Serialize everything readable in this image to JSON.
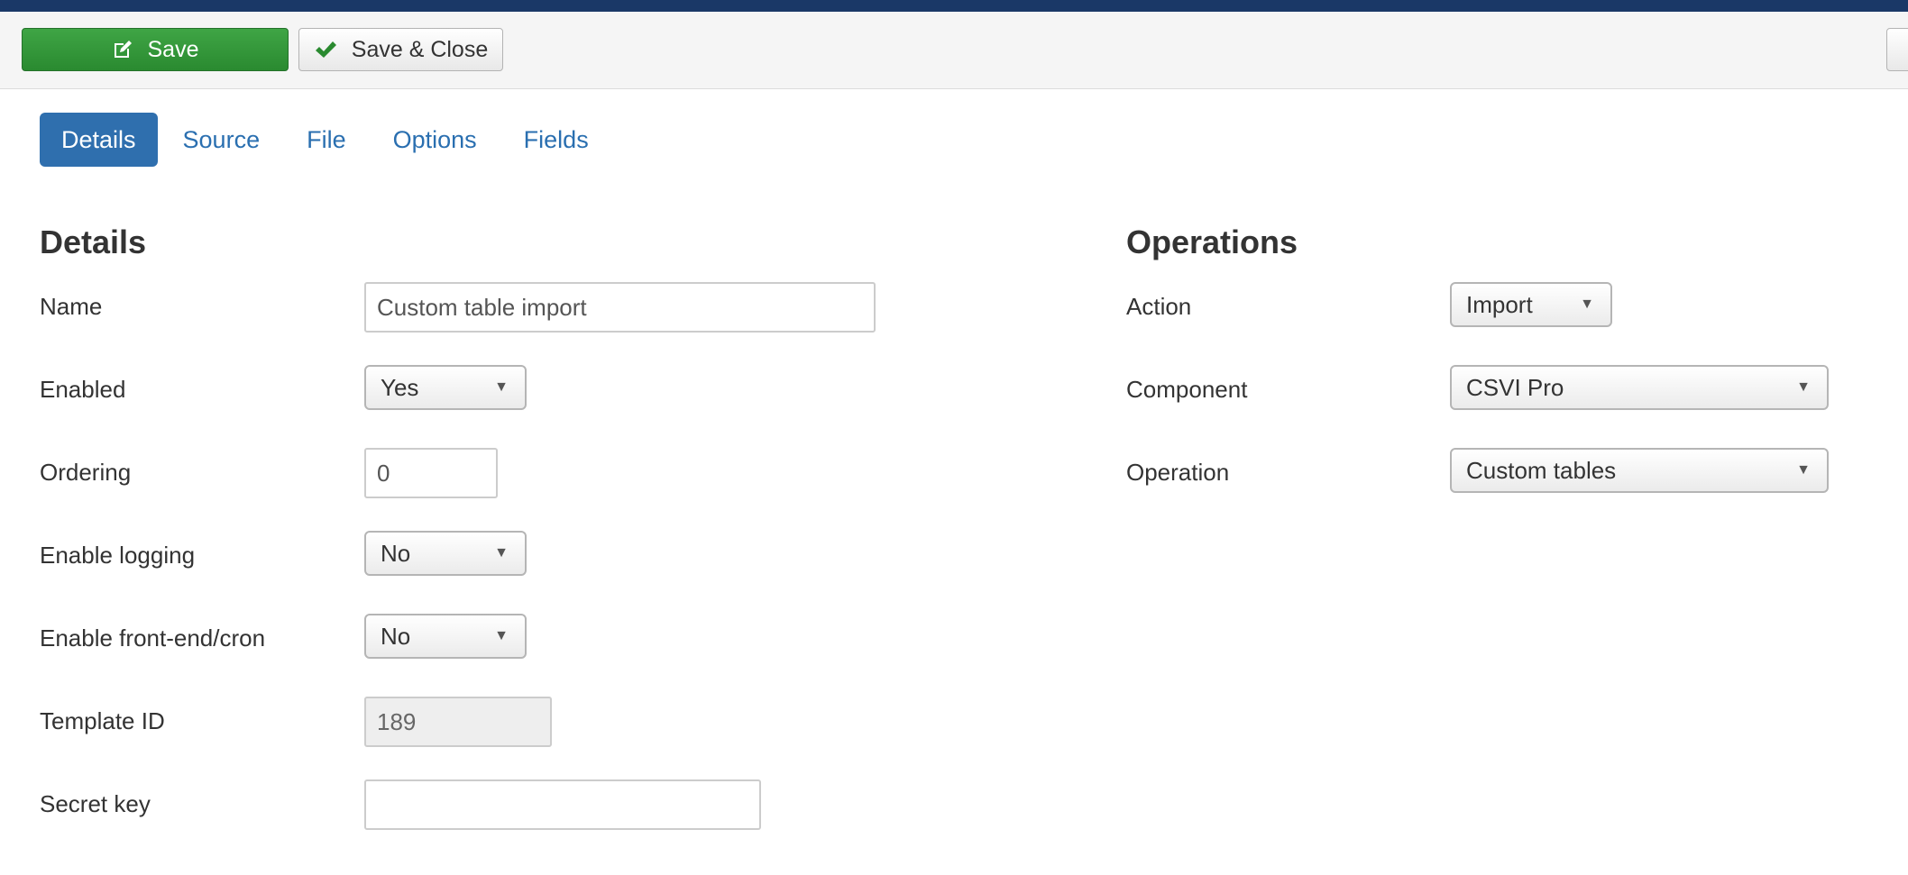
{
  "toolbar": {
    "save_label": "Save",
    "save_close_label": "Save & Close",
    "save_icon": "edit-icon",
    "save_close_icon": "check-icon"
  },
  "tabs": [
    {
      "label": "Details",
      "active": true
    },
    {
      "label": "Source",
      "active": false
    },
    {
      "label": "File",
      "active": false
    },
    {
      "label": "Options",
      "active": false
    },
    {
      "label": "Fields",
      "active": false
    }
  ],
  "details": {
    "title": "Details",
    "name_label": "Name",
    "name_value": "Custom table import",
    "enabled_label": "Enabled",
    "enabled_value": "Yes",
    "ordering_label": "Ordering",
    "ordering_value": "0",
    "logging_label": "Enable logging",
    "logging_value": "No",
    "frontend_label": "Enable front-end/cron",
    "frontend_value": "No",
    "template_id_label": "Template ID",
    "template_id_value": "189",
    "secret_key_label": "Secret key",
    "secret_key_value": ""
  },
  "operations": {
    "title": "Operations",
    "action_label": "Action",
    "action_value": "Import",
    "component_label": "Component",
    "component_value": "CSVI Pro",
    "operation_label": "Operation",
    "operation_value": "Custom tables"
  },
  "colors": {
    "topbar": "#1a3867",
    "save_green": "#2f9a35",
    "active_tab": "#2f6fae",
    "link_blue": "#2a6fb0"
  }
}
